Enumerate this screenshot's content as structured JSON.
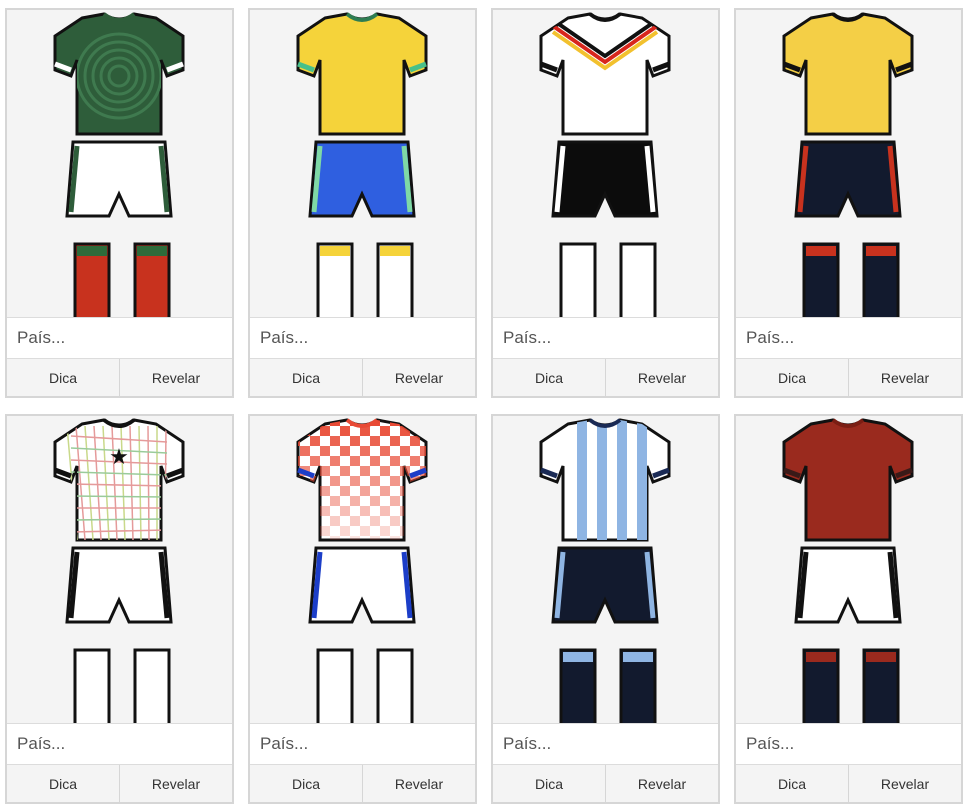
{
  "cards": [
    {
      "placeholder": "País...",
      "hint": "Dica",
      "reveal": "Revelar",
      "kit": {
        "shirt": "#2e5d3a",
        "shirt_pattern": "aztec-calendar",
        "collar": "#2e5d3a",
        "trim": "#ffffff",
        "shorts": "#ffffff",
        "shorts_stripe": "#2e5d3a",
        "socks": "#c8321e",
        "sock_top": "#2e6b3a"
      }
    },
    {
      "placeholder": "País...",
      "hint": "Dica",
      "reveal": "Revelar",
      "kit": {
        "shirt": "#f5d33a",
        "shirt_pattern": "plain",
        "collar": "#2e7d52",
        "trim": "#47c08a",
        "shorts": "#2f5fe0",
        "shorts_stripe": "#7fd9a6",
        "socks": "#ffffff",
        "sock_top": "#f5d33a"
      }
    },
    {
      "placeholder": "País...",
      "hint": "Dica",
      "reveal": "Revelar",
      "kit": {
        "shirt": "#ffffff",
        "shirt_pattern": "flag-chevrons",
        "collar": "#111111",
        "trim": "#111111",
        "shorts": "#0c0c0c",
        "shorts_stripe": "#ffffff",
        "socks": "#ffffff",
        "sock_top": "#ffffff"
      }
    },
    {
      "placeholder": "País...",
      "hint": "Dica",
      "reveal": "Revelar",
      "kit": {
        "shirt": "#f4cf46",
        "shirt_pattern": "plain",
        "collar": "#111111",
        "trim": "#111111",
        "shorts": "#121a2e",
        "shorts_stripe": "#c8321e",
        "socks": "#121a2e",
        "sock_top": "#c8321e"
      }
    },
    {
      "placeholder": "País...",
      "hint": "Dica",
      "reveal": "Revelar",
      "kit": {
        "shirt": "#ffffff",
        "shirt_pattern": "city-map",
        "collar": "#111111",
        "trim": "#111111",
        "shorts": "#ffffff",
        "shorts_stripe": "#111111",
        "socks": "#ffffff",
        "sock_top": "#ffffff"
      }
    },
    {
      "placeholder": "País...",
      "hint": "Dica",
      "reveal": "Revelar",
      "kit": {
        "shirt": "#ffffff",
        "shirt_pattern": "checkers",
        "collar": "#e84a35",
        "trim": "#1c3ec8",
        "shorts": "#ffffff",
        "shorts_stripe": "#1c3ec8",
        "socks": "#ffffff",
        "sock_top": "#ffffff"
      }
    },
    {
      "placeholder": "País...",
      "hint": "Dica",
      "reveal": "Revelar",
      "kit": {
        "shirt": "#ffffff",
        "shirt_pattern": "sky-stripes",
        "collar": "#1a2a55",
        "trim": "#1a2a55",
        "shorts": "#121a2e",
        "shorts_stripe": "#8fb5e3",
        "socks": "#121a2e",
        "sock_top": "#8fb5e3"
      }
    },
    {
      "placeholder": "País...",
      "hint": "Dica",
      "reveal": "Revelar",
      "kit": {
        "shirt": "#9a2a1e",
        "shirt_pattern": "plain",
        "collar": "#7a1e14",
        "trim": "#3a1a18",
        "shorts": "#ffffff",
        "shorts_stripe": "#111111",
        "socks": "#121a2e",
        "sock_top": "#9a2a1e"
      }
    }
  ]
}
